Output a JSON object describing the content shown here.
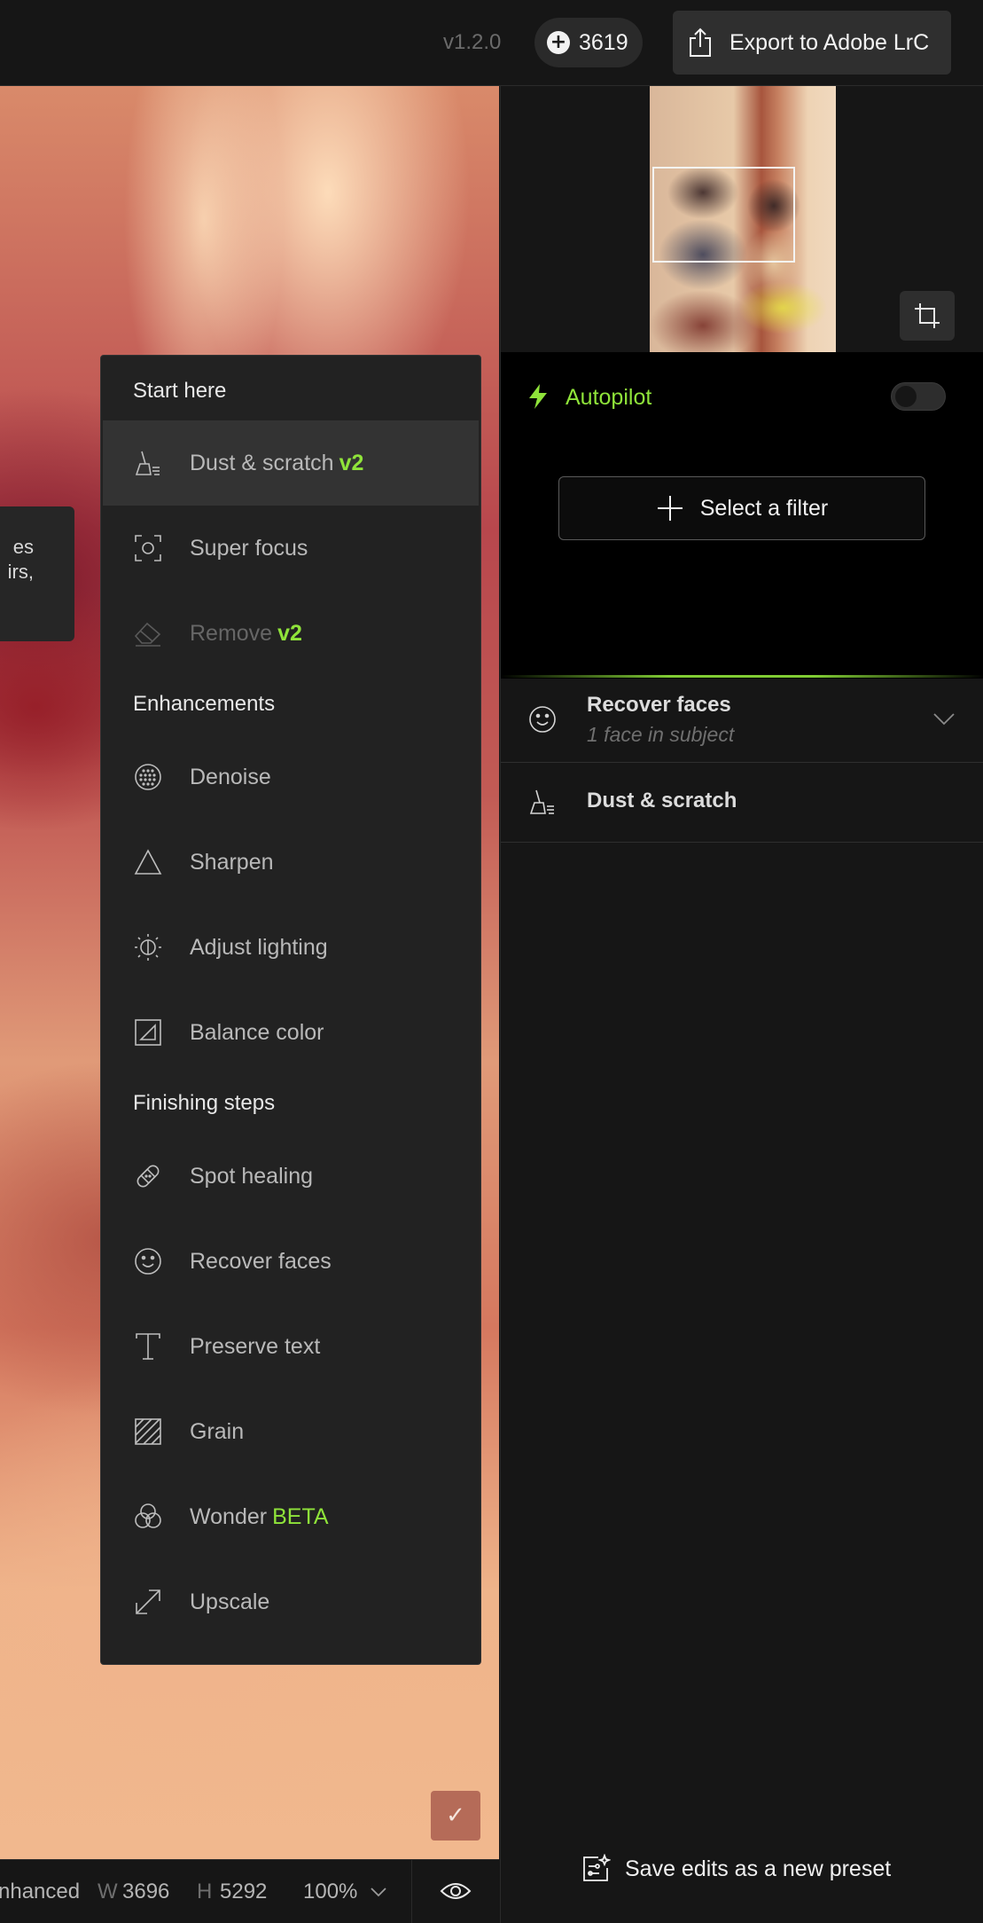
{
  "header": {
    "version": "v1.2.0",
    "credits": "3619",
    "export_label": "Export to Adobe LrC"
  },
  "canvas": {
    "tooltip_lines": [
      "es",
      "irs,"
    ],
    "confirm_glyph": "✓"
  },
  "menu": {
    "sections": [
      {
        "title": "Start here",
        "items": [
          {
            "label": "Dust & scratch",
            "tag": "v2",
            "icon": "broom-icon",
            "active": true,
            "disabled": false
          },
          {
            "label": "Super focus",
            "tag": "",
            "icon": "focus-icon",
            "active": false,
            "disabled": false
          },
          {
            "label": "Remove",
            "tag": "v2",
            "icon": "eraser-icon",
            "active": false,
            "disabled": true
          }
        ]
      },
      {
        "title": "Enhancements",
        "items": [
          {
            "label": "Denoise",
            "tag": "",
            "icon": "denoise-icon"
          },
          {
            "label": "Sharpen",
            "tag": "",
            "icon": "triangle-icon"
          },
          {
            "label": "Adjust lighting",
            "tag": "",
            "icon": "lighting-icon"
          },
          {
            "label": "Balance color",
            "tag": "",
            "icon": "balance-color-icon"
          }
        ]
      },
      {
        "title": "Finishing steps",
        "items": [
          {
            "label": "Spot healing",
            "tag": "",
            "icon": "bandage-icon"
          },
          {
            "label": "Recover faces",
            "tag": "",
            "icon": "smiley-icon"
          },
          {
            "label": "Preserve text",
            "tag": "",
            "icon": "text-icon"
          },
          {
            "label": "Grain",
            "tag": "",
            "icon": "grain-icon"
          },
          {
            "label": "Wonder",
            "tag": "BETA",
            "icon": "wonder-icon"
          },
          {
            "label": "Upscale",
            "tag": "",
            "icon": "upscale-icon"
          }
        ]
      }
    ]
  },
  "status_bar": {
    "mode": "nhanced",
    "width_label": "W",
    "width_value": "3696",
    "height_label": "H",
    "height_value": "5292",
    "zoom": "100%"
  },
  "panel": {
    "autopilot_label": "Autopilot",
    "autopilot_on": false,
    "select_filter_label": "Select a filter",
    "applied_filters": [
      {
        "title": "Recover faces",
        "subtitle": "1 face in subject",
        "icon": "smiley-icon",
        "expandable": true
      },
      {
        "title": "Dust & scratch",
        "subtitle": "",
        "icon": "broom-icon",
        "expandable": false
      }
    ],
    "save_preset_label": "Save edits as a new preset"
  },
  "colors": {
    "accent_green": "#8fe33a",
    "background": "#161616",
    "menu_background": "#222222"
  }
}
